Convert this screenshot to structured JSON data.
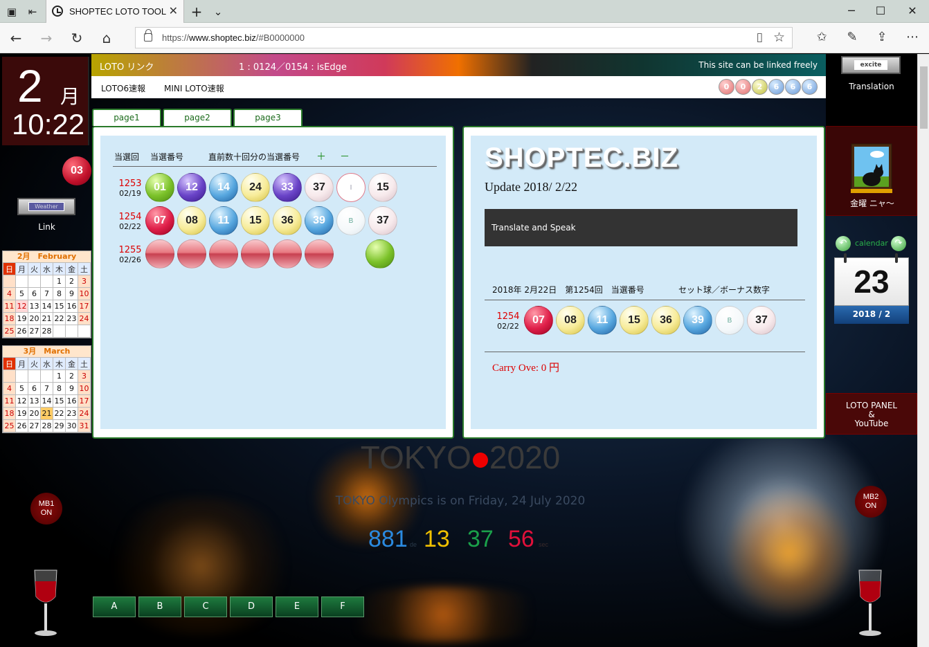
{
  "browser": {
    "tab_title": "SHOPTEC LOTO TOOL",
    "url_prefix": "https://",
    "url_domain": "www.shoptec.biz",
    "url_path": "/#B0000000"
  },
  "clock": {
    "month": "2",
    "month_kanji": "月",
    "time": "10:22"
  },
  "left": {
    "day_badge": "03",
    "weather_badge": "Weather",
    "link_label": "Link",
    "mb1_line1": "MB1",
    "mb1_line2": "ON"
  },
  "feb_calendar": {
    "header": "2月　February",
    "weekdays": [
      "日",
      "月",
      "火",
      "水",
      "木",
      "金",
      "土"
    ],
    "weeks": [
      [
        "",
        "",
        "",
        "",
        "1",
        "2",
        "3"
      ],
      [
        "4",
        "5",
        "6",
        "7",
        "8",
        "9",
        "10"
      ],
      [
        "11",
        "12",
        "13",
        "14",
        "15",
        "16",
        "17"
      ],
      [
        "18",
        "19",
        "20",
        "21",
        "22",
        "23",
        "24"
      ],
      [
        "25",
        "26",
        "27",
        "28",
        "",
        "",
        ""
      ]
    ]
  },
  "mar_calendar": {
    "header": "3月　March",
    "weekdays": [
      "日",
      "月",
      "火",
      "水",
      "木",
      "金",
      "土"
    ],
    "weeks": [
      [
        "",
        "",
        "",
        "",
        "1",
        "2",
        "3"
      ],
      [
        "4",
        "5",
        "6",
        "7",
        "8",
        "9",
        "10"
      ],
      [
        "11",
        "12",
        "13",
        "14",
        "15",
        "16",
        "17"
      ],
      [
        "18",
        "19",
        "20",
        "21",
        "22",
        "23",
        "24"
      ],
      [
        "25",
        "26",
        "27",
        "28",
        "29",
        "30",
        "31"
      ]
    ]
  },
  "banner": {
    "loto_link": "LOTO リンク",
    "counter": "1 : 0124／0154 : isEdge",
    "free_link": "This site can be linked freely"
  },
  "subnav": {
    "loto6": "LOTO6速報",
    "miniloto": "MINI LOTO速報",
    "counter_digits": [
      "0",
      "0",
      "2",
      "6",
      "6",
      "6"
    ]
  },
  "tabs": [
    "page1",
    "page2",
    "page3"
  ],
  "left_panel": {
    "col_round": "当選回",
    "col_number": "当選番号",
    "col_recent": "直前数十回分の当選番号",
    "plus": "＋",
    "minus": "－",
    "rows": [
      {
        "round": "1253",
        "date": "02/19",
        "balls": [
          "01",
          "12",
          "14",
          "24",
          "33",
          "37",
          "I",
          "15"
        ]
      },
      {
        "round": "1254",
        "date": "02/22",
        "balls": [
          "07",
          "08",
          "11",
          "15",
          "36",
          "39",
          "B",
          "37"
        ]
      },
      {
        "round": "1255",
        "date": "02/26",
        "balls": [
          "",
          "",
          "",
          "",
          "",
          "",
          "",
          ""
        ]
      }
    ]
  },
  "right_panel": {
    "logo": "SHOPTEC.BIZ",
    "update": "Update 2018/ 2/22",
    "translate": "Translate and Speak",
    "result_date": "2018年 2月22日　第1254回　当選番号",
    "result_set": "セット球／ボーナス数字",
    "round": "1254",
    "date": "02/22",
    "balls": [
      "07",
      "08",
      "11",
      "15",
      "36",
      "39",
      "B",
      "37"
    ],
    "carry": "Carry Ove: 0 円"
  },
  "right_col": {
    "excite": "excite",
    "translation": "Translation",
    "cat_label": "金曜 ニャ～",
    "calendar_label": "calendar",
    "cal_day": "23",
    "cal_month": "2018 / 2",
    "loto_panel_1": "LOTO PANEL",
    "loto_panel_2": "&",
    "loto_panel_3": "YouTube",
    "mb2_line1": "MB2",
    "mb2_line2": "ON"
  },
  "tokyo": {
    "title_left": "TOKYO",
    "title_right": "2020",
    "subtitle": "TOKYO Olympics is on Friday, 24 July 2020",
    "days": "881",
    "days_unit": "de",
    "hours": "13",
    "minutes": "37",
    "seconds": "56",
    "seconds_unit": "sec"
  },
  "bottom_buttons": [
    "A",
    "B",
    "C",
    "D",
    "E",
    "F"
  ],
  "colors": {
    "accent_green": "#2a7a2a",
    "red": "#d00000",
    "panel_bg": "#d3eaf8"
  }
}
